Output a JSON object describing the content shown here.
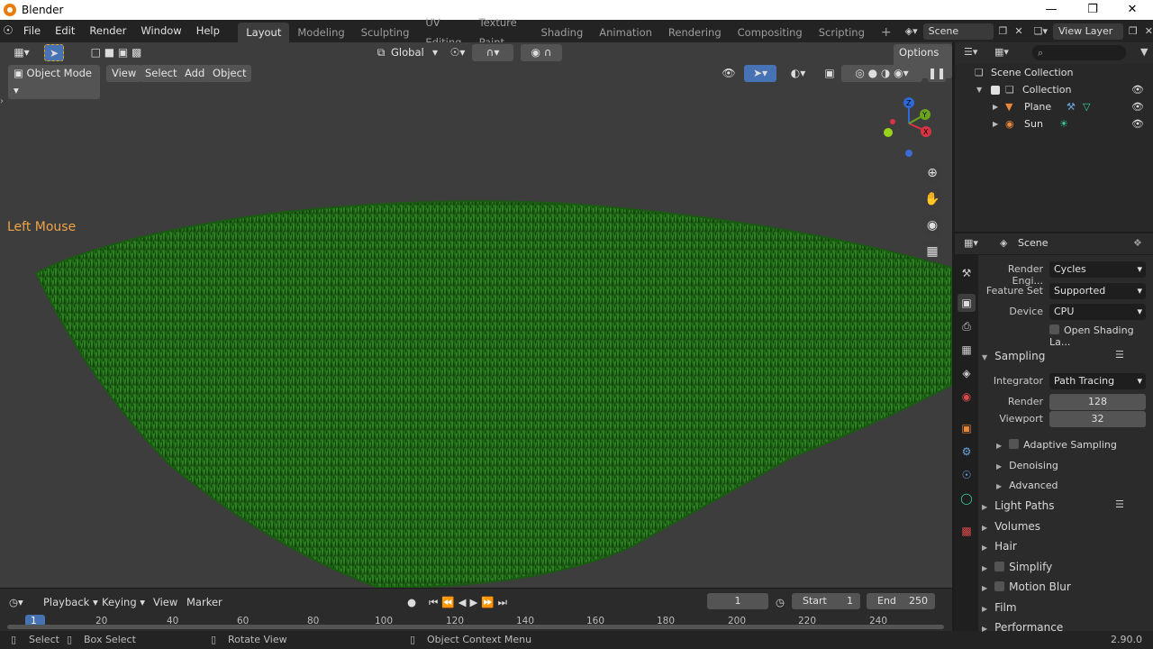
{
  "window": {
    "title": "Blender"
  },
  "menu": {
    "items": [
      "File",
      "Edit",
      "Render",
      "Window",
      "Help"
    ]
  },
  "workspaces": [
    "Layout",
    "Modeling",
    "Sculpting",
    "UV Editing",
    "Texture Paint",
    "Shading",
    "Animation",
    "Rendering",
    "Compositing",
    "Scripting"
  ],
  "active_workspace": "Layout",
  "scene_field": "Scene",
  "view_layer_field": "View Layer",
  "toolbar": {
    "transform_orientation": "Global",
    "options_label": "Options"
  },
  "viewport": {
    "mode": "Object Mode",
    "menus": [
      "View",
      "Select",
      "Add",
      "Object"
    ],
    "overlay_text": "Left Mouse",
    "gizmo": {
      "z": "Z",
      "y": "Y",
      "x": "X"
    }
  },
  "timeline": {
    "menus": [
      "Playback",
      "Keying",
      "View",
      "Marker"
    ],
    "current_frame": "1",
    "start_label": "Start",
    "start_value": "1",
    "end_label": "End",
    "end_value": "250",
    "ticks": [
      "1",
      "20",
      "40",
      "60",
      "80",
      "100",
      "120",
      "140",
      "160",
      "180",
      "200",
      "220",
      "240"
    ]
  },
  "statusbar": {
    "select": "Select",
    "box_select": "Box Select",
    "rotate_view": "Rotate View",
    "context_menu": "Object Context Menu",
    "version": "2.90.0"
  },
  "outliner": {
    "root": "Scene Collection",
    "collection": "Collection",
    "objects": [
      "Plane",
      "Sun"
    ]
  },
  "properties": {
    "context": "Scene",
    "render_engine_label": "Render Engi...",
    "render_engine": "Cycles",
    "feature_set_label": "Feature Set",
    "feature_set": "Supported",
    "device_label": "Device",
    "device": "CPU",
    "open_shading": "Open Shading La...",
    "sampling": {
      "title": "Sampling",
      "integrator_label": "Integrator",
      "integrator": "Path Tracing",
      "render_label": "Render",
      "render": "128",
      "viewport_label": "Viewport",
      "viewport": "32",
      "subpanels": [
        "Adaptive Sampling",
        "Denoising",
        "Advanced"
      ]
    },
    "panels": [
      "Light Paths",
      "Volumes",
      "Hair",
      "Simplify",
      "Motion Blur",
      "Film",
      "Performance"
    ]
  },
  "colors": {
    "accent": "#4772b3",
    "grass": "#1f6b17",
    "viewport_bg": "#3d3d3d"
  }
}
